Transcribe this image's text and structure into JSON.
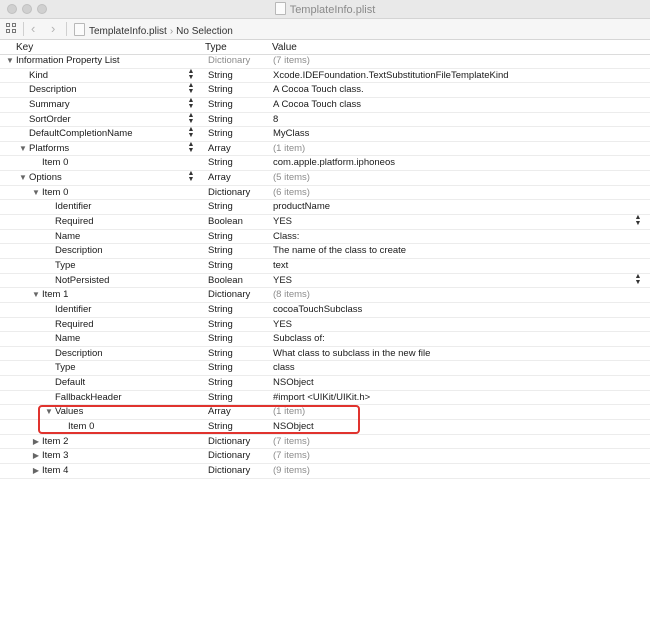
{
  "window": {
    "title": "TemplateInfo.plist"
  },
  "jumpbar": {
    "file": "TemplateInfo.plist",
    "selection": "No Selection"
  },
  "columns": {
    "key": "Key",
    "type": "Type",
    "value": "Value"
  },
  "rows": [
    {
      "level": 0,
      "disclosure": "expanded",
      "key": "Information Property List",
      "type": "Dictionary",
      "value": "(7 items)",
      "dim_type": true,
      "dim_value": true,
      "stepper": false
    },
    {
      "level": 1,
      "disclosure": "none",
      "key": "Kind",
      "type": "String",
      "value": "Xcode.IDEFoundation.TextSubstitutionFileTemplateKind",
      "stepper": true
    },
    {
      "level": 1,
      "disclosure": "none",
      "key": "Description",
      "type": "String",
      "value": "A Cocoa Touch class.",
      "stepper": true
    },
    {
      "level": 1,
      "disclosure": "none",
      "key": "Summary",
      "type": "String",
      "value": "A Cocoa Touch class",
      "stepper": true
    },
    {
      "level": 1,
      "disclosure": "none",
      "key": "SortOrder",
      "type": "String",
      "value": "8",
      "stepper": true
    },
    {
      "level": 1,
      "disclosure": "none",
      "key": "DefaultCompletionName",
      "type": "String",
      "value": "MyClass",
      "stepper": true
    },
    {
      "level": 1,
      "disclosure": "expanded",
      "key": "Platforms",
      "type": "Array",
      "value": "(1 item)",
      "dim_value": true,
      "stepper": true
    },
    {
      "level": 2,
      "disclosure": "none",
      "key": "Item 0",
      "type": "String",
      "value": "com.apple.platform.iphoneos"
    },
    {
      "level": 1,
      "disclosure": "expanded",
      "key": "Options",
      "type": "Array",
      "value": "(5 items)",
      "dim_value": true,
      "stepper": true
    },
    {
      "level": 2,
      "disclosure": "expanded",
      "key": "Item 0",
      "type": "Dictionary",
      "value": "(6 items)",
      "dim_value": true
    },
    {
      "level": 3,
      "disclosure": "none",
      "key": "Identifier",
      "type": "String",
      "value": "productName"
    },
    {
      "level": 3,
      "disclosure": "none",
      "key": "Required",
      "type": "Boolean",
      "value": "YES",
      "value_stepper": true
    },
    {
      "level": 3,
      "disclosure": "none",
      "key": "Name",
      "type": "String",
      "value": "Class:"
    },
    {
      "level": 3,
      "disclosure": "none",
      "key": "Description",
      "type": "String",
      "value": "The name of the class to create"
    },
    {
      "level": 3,
      "disclosure": "none",
      "key": "Type",
      "type": "String",
      "value": "text"
    },
    {
      "level": 3,
      "disclosure": "none",
      "key": "NotPersisted",
      "type": "Boolean",
      "value": "YES",
      "value_stepper": true
    },
    {
      "level": 2,
      "disclosure": "expanded",
      "key": "Item 1",
      "type": "Dictionary",
      "value": "(8 items)",
      "dim_value": true
    },
    {
      "level": 3,
      "disclosure": "none",
      "key": "Identifier",
      "type": "String",
      "value": "cocoaTouchSubclass"
    },
    {
      "level": 3,
      "disclosure": "none",
      "key": "Required",
      "type": "String",
      "value": "YES"
    },
    {
      "level": 3,
      "disclosure": "none",
      "key": "Name",
      "type": "String",
      "value": "Subclass of:"
    },
    {
      "level": 3,
      "disclosure": "none",
      "key": "Description",
      "type": "String",
      "value": "What class to subclass in the new file"
    },
    {
      "level": 3,
      "disclosure": "none",
      "key": "Type",
      "type": "String",
      "value": "class"
    },
    {
      "level": 3,
      "disclosure": "none",
      "key": "Default",
      "type": "String",
      "value": "NSObject"
    },
    {
      "level": 3,
      "disclosure": "none",
      "key": "FallbackHeader",
      "type": "String",
      "value": "#import <UIKit/UIKit.h>"
    },
    {
      "level": 3,
      "disclosure": "expanded",
      "key": "Values",
      "type": "Array",
      "value": "(1 item)",
      "dim_value": true
    },
    {
      "level": 4,
      "disclosure": "none",
      "key": "Item 0",
      "type": "String",
      "value": "NSObject"
    },
    {
      "level": 2,
      "disclosure": "collapsed",
      "key": "Item 2",
      "type": "Dictionary",
      "value": "(7 items)",
      "dim_value": true
    },
    {
      "level": 2,
      "disclosure": "collapsed",
      "key": "Item 3",
      "type": "Dictionary",
      "value": "(7 items)",
      "dim_value": true
    },
    {
      "level": 2,
      "disclosure": "collapsed",
      "key": "Item 4",
      "type": "Dictionary",
      "value": "(9 items)",
      "dim_value": true
    }
  ],
  "annotation": {
    "color": "#e0332e"
  }
}
